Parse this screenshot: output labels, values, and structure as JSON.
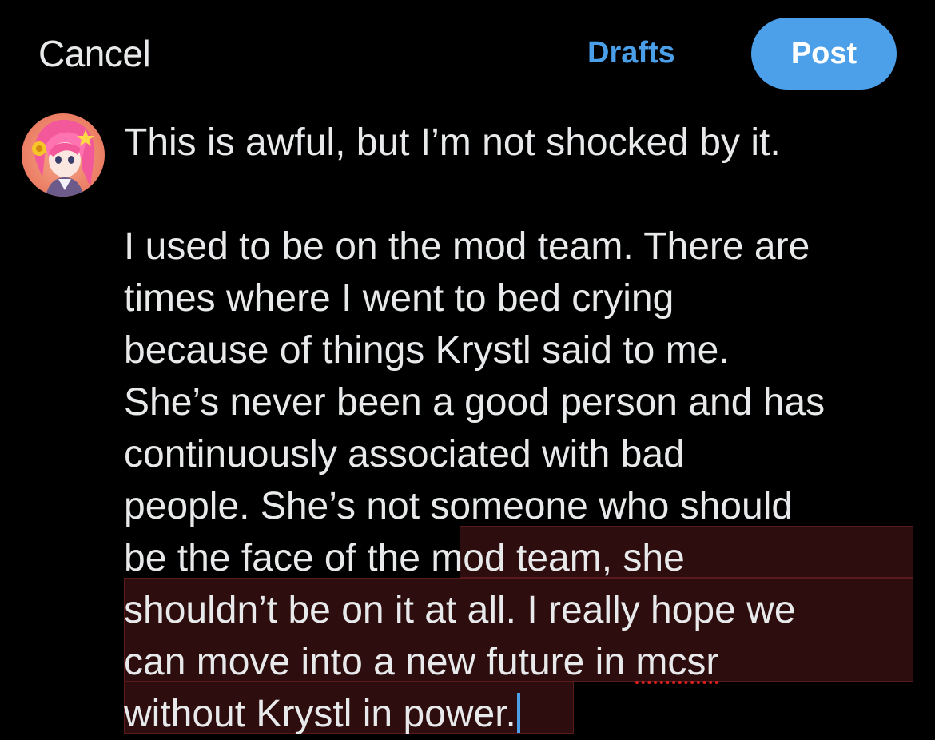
{
  "header": {
    "cancel_label": "Cancel",
    "drafts_label": "Drafts",
    "post_label": "Post"
  },
  "colors": {
    "accent": "#4c9fe9",
    "background": "#000000",
    "text": "#e7e9ea",
    "selection": "#2d0d0e",
    "spellcheck": "#e02020"
  },
  "avatar": {
    "icon": "anime-character-avatar-icon"
  },
  "composer": {
    "line1": "This is awful, but I’m not shocked by it.",
    "line2": "I used to be on the mod team. There are",
    "line3": "times where I went to bed crying",
    "line4": "because of things Krystl said to me.",
    "line5": "She’s never been a good person and has",
    "line6": "continuously associated with bad",
    "line7": "people. She’s not someone who should",
    "line8_plain": "be the face of the ",
    "line8_selected": "mod team, she",
    "line9": "shouldn’t be on it at all. I really hope we",
    "line10_pre": "can move into a new future in ",
    "line10_misspelled": "mcsr",
    "line11": "without Krystl in power."
  }
}
